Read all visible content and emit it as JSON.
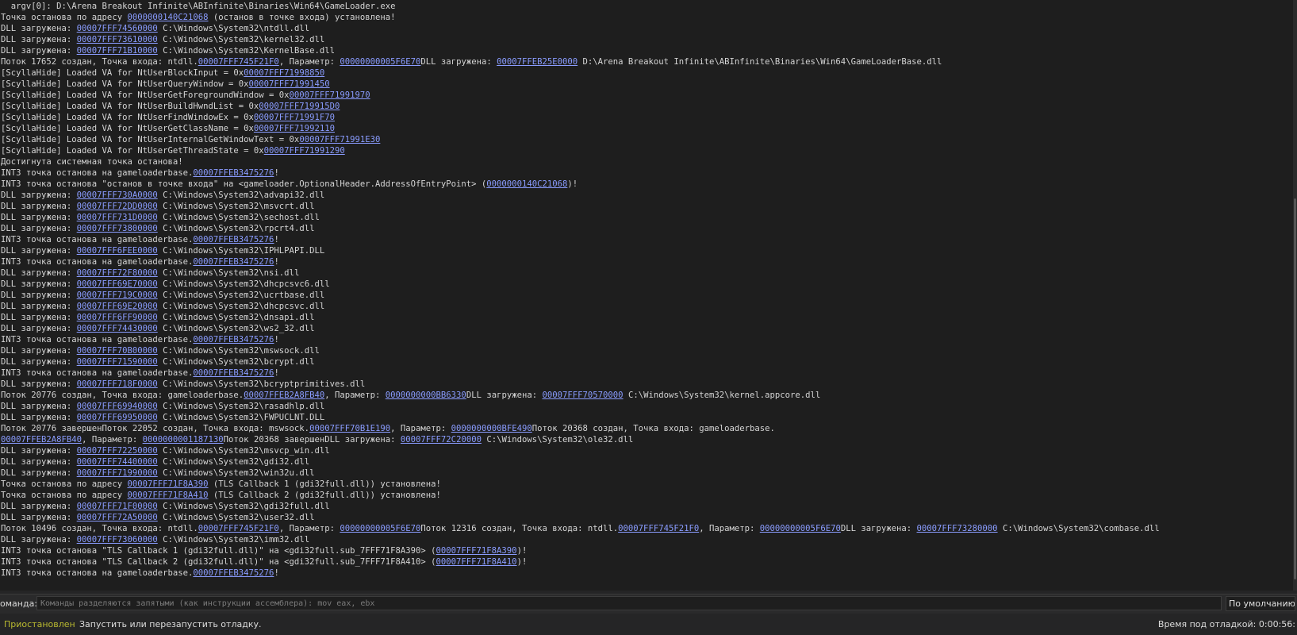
{
  "log": {
    "lines": [
      [
        {
          "t": "  argv[0]: D:\\Arena Breakout Infinite\\ABInfinite\\Binaries\\Win64\\GameLoader.exe"
        }
      ],
      [
        {
          "t": "Точка останова по адресу "
        },
        {
          "t": "0000000140C21068",
          "a": true
        },
        {
          "t": " (останов в точке входа) установлена!"
        }
      ],
      [
        {
          "t": "DLL загружена: "
        },
        {
          "t": "00007FFF74560000",
          "a": true
        },
        {
          "t": " C:\\Windows\\System32\\ntdll.dll"
        }
      ],
      [
        {
          "t": "DLL загружена: "
        },
        {
          "t": "00007FFF73610000",
          "a": true
        },
        {
          "t": " C:\\Windows\\System32\\kernel32.dll"
        }
      ],
      [
        {
          "t": "DLL загружена: "
        },
        {
          "t": "00007FFF71B10000",
          "a": true
        },
        {
          "t": " C:\\Windows\\System32\\KernelBase.dll"
        }
      ],
      [
        {
          "t": "Поток 17652 создан, Точка входа: ntdll."
        },
        {
          "t": "00007FFF745F21F0",
          "a": true
        },
        {
          "t": ", Параметр: "
        },
        {
          "t": "00000000005F6E70",
          "a": true
        },
        {
          "t": "DLL загружена: "
        },
        {
          "t": "00007FFEB25E0000",
          "a": true
        },
        {
          "t": " D:\\Arena Breakout Infinite\\ABInfinite\\Binaries\\Win64\\GameLoaderBase.dll"
        }
      ],
      [
        {
          "t": "[ScyllaHide] Loaded VA for NtUserBlockInput = 0x"
        },
        {
          "t": "00007FFF71998850",
          "a": true
        }
      ],
      [
        {
          "t": "[ScyllaHide] Loaded VA for NtUserQueryWindow = 0x"
        },
        {
          "t": "00007FFF71991450",
          "a": true
        }
      ],
      [
        {
          "t": "[ScyllaHide] Loaded VA for NtUserGetForegroundWindow = 0x"
        },
        {
          "t": "00007FFF71991970",
          "a": true
        }
      ],
      [
        {
          "t": "[ScyllaHide] Loaded VA for NtUserBuildHwndList = 0x"
        },
        {
          "t": "00007FFF719915D0",
          "a": true
        }
      ],
      [
        {
          "t": "[ScyllaHide] Loaded VA for NtUserFindWindowEx = 0x"
        },
        {
          "t": "00007FFF71991F70",
          "a": true
        }
      ],
      [
        {
          "t": "[ScyllaHide] Loaded VA for NtUserGetClassName = 0x"
        },
        {
          "t": "00007FFF71992110",
          "a": true
        }
      ],
      [
        {
          "t": "[ScyllaHide] Loaded VA for NtUserInternalGetWindowText = 0x"
        },
        {
          "t": "00007FFF71991E30",
          "a": true
        }
      ],
      [
        {
          "t": "[ScyllaHide] Loaded VA for NtUserGetThreadState = 0x"
        },
        {
          "t": "00007FFF71991290",
          "a": true
        }
      ],
      [
        {
          "t": "Достигнута системная точка останова!"
        }
      ],
      [
        {
          "t": "INT3 точка останова на gameloaderbase."
        },
        {
          "t": "00007FFEB3475276",
          "a": true
        },
        {
          "t": "!"
        }
      ],
      [
        {
          "t": "INT3 точка останова \"останов в точке входа\" на <gameloader.OptionalHeader.AddressOfEntryPoint> ("
        },
        {
          "t": "0000000140C21068",
          "a": true
        },
        {
          "t": ")!"
        }
      ],
      [
        {
          "t": "DLL загружена: "
        },
        {
          "t": "00007FFF730A0000",
          "a": true
        },
        {
          "t": " C:\\Windows\\System32\\advapi32.dll"
        }
      ],
      [
        {
          "t": "DLL загружена: "
        },
        {
          "t": "00007FFF72DD0000",
          "a": true
        },
        {
          "t": " C:\\Windows\\System32\\msvcrt.dll"
        }
      ],
      [
        {
          "t": "DLL загружена: "
        },
        {
          "t": "00007FFF731D0000",
          "a": true
        },
        {
          "t": " C:\\Windows\\System32\\sechost.dll"
        }
      ],
      [
        {
          "t": "DLL загружена: "
        },
        {
          "t": "00007FFF73800000",
          "a": true
        },
        {
          "t": " C:\\Windows\\System32\\rpcrt4.dll"
        }
      ],
      [
        {
          "t": "INT3 точка останова на gameloaderbase."
        },
        {
          "t": "00007FFEB3475276",
          "a": true
        },
        {
          "t": "!"
        }
      ],
      [
        {
          "t": "DLL загружена: "
        },
        {
          "t": "00007FFF6FEE0000",
          "a": true
        },
        {
          "t": " C:\\Windows\\System32\\IPHLPAPI.DLL"
        }
      ],
      [
        {
          "t": "INT3 точка останова на gameloaderbase."
        },
        {
          "t": "00007FFEB3475276",
          "a": true
        },
        {
          "t": "!"
        }
      ],
      [
        {
          "t": "DLL загружена: "
        },
        {
          "t": "00007FFF72F80000",
          "a": true
        },
        {
          "t": " C:\\Windows\\System32\\nsi.dll"
        }
      ],
      [
        {
          "t": "DLL загружена: "
        },
        {
          "t": "00007FFF69E70000",
          "a": true
        },
        {
          "t": " C:\\Windows\\System32\\dhcpcsvc6.dll"
        }
      ],
      [
        {
          "t": "DLL загружена: "
        },
        {
          "t": "00007FFF719C0000",
          "a": true
        },
        {
          "t": " C:\\Windows\\System32\\ucrtbase.dll"
        }
      ],
      [
        {
          "t": "DLL загружена: "
        },
        {
          "t": "00007FFF69E20000",
          "a": true
        },
        {
          "t": " C:\\Windows\\System32\\dhcpcsvc.dll"
        }
      ],
      [
        {
          "t": "DLL загружена: "
        },
        {
          "t": "00007FFF6FF90000",
          "a": true
        },
        {
          "t": " C:\\Windows\\System32\\dnsapi.dll"
        }
      ],
      [
        {
          "t": "DLL загружена: "
        },
        {
          "t": "00007FFF74430000",
          "a": true
        },
        {
          "t": " C:\\Windows\\System32\\ws2_32.dll"
        }
      ],
      [
        {
          "t": "INT3 точка останова на gameloaderbase."
        },
        {
          "t": "00007FFEB3475276",
          "a": true
        },
        {
          "t": "!"
        }
      ],
      [
        {
          "t": "DLL загружена: "
        },
        {
          "t": "00007FFF70B00000",
          "a": true
        },
        {
          "t": " C:\\Windows\\System32\\mswsock.dll"
        }
      ],
      [
        {
          "t": "DLL загружена: "
        },
        {
          "t": "00007FFF71590000",
          "a": true
        },
        {
          "t": " C:\\Windows\\System32\\bcrypt.dll"
        }
      ],
      [
        {
          "t": "INT3 точка останова на gameloaderbase."
        },
        {
          "t": "00007FFEB3475276",
          "a": true
        },
        {
          "t": "!"
        }
      ],
      [
        {
          "t": "DLL загружена: "
        },
        {
          "t": "00007FFF718F0000",
          "a": true
        },
        {
          "t": " C:\\Windows\\System32\\bcryptprimitives.dll"
        }
      ],
      [
        {
          "t": "Поток 20776 создан, Точка входа: gameloaderbase."
        },
        {
          "t": "00007FFEB2A8FB40",
          "a": true
        },
        {
          "t": ", Параметр: "
        },
        {
          "t": "0000000000BB6330",
          "a": true
        },
        {
          "t": "DLL загружена: "
        },
        {
          "t": "00007FFF70570000",
          "a": true
        },
        {
          "t": " C:\\Windows\\System32\\kernel.appcore.dll"
        }
      ],
      [
        {
          "t": "DLL загружена: "
        },
        {
          "t": "00007FFF69940000",
          "a": true
        },
        {
          "t": " C:\\Windows\\System32\\rasadhlp.dll"
        }
      ],
      [
        {
          "t": "DLL загружена: "
        },
        {
          "t": "00007FFF69950000",
          "a": true
        },
        {
          "t": " C:\\Windows\\System32\\FWPUCLNT.DLL"
        }
      ],
      [
        {
          "t": "Поток 20776 завершенПоток 22052 создан, Точка входа: mswsock."
        },
        {
          "t": "00007FFF70B1E190",
          "a": true
        },
        {
          "t": ", Параметр: "
        },
        {
          "t": "0000000000BFE490",
          "a": true
        },
        {
          "t": "Поток 20368 создан, Точка входа: gameloaderbase."
        }
      ],
      [
        {
          "t": "00007FFEB2A8FB40",
          "a": true
        },
        {
          "t": ", Параметр: "
        },
        {
          "t": "0000000001187130",
          "a": true
        },
        {
          "t": "Поток 20368 завершенDLL загружена: "
        },
        {
          "t": "00007FFF72C20000",
          "a": true
        },
        {
          "t": " C:\\Windows\\System32\\ole32.dll"
        }
      ],
      [
        {
          "t": "DLL загружена: "
        },
        {
          "t": "00007FFF72250000",
          "a": true
        },
        {
          "t": " C:\\Windows\\System32\\msvcp_win.dll"
        }
      ],
      [
        {
          "t": "DLL загружена: "
        },
        {
          "t": "00007FFF74400000",
          "a": true
        },
        {
          "t": " C:\\Windows\\System32\\gdi32.dll"
        }
      ],
      [
        {
          "t": "DLL загружена: "
        },
        {
          "t": "00007FFF71990000",
          "a": true
        },
        {
          "t": " C:\\Windows\\System32\\win32u.dll"
        }
      ],
      [
        {
          "t": "Точка останова по адресу "
        },
        {
          "t": "00007FFF71F8A390",
          "a": true
        },
        {
          "t": " (TLS Callback 1 (gdi32full.dll)) установлена!"
        }
      ],
      [
        {
          "t": "Точка останова по адресу "
        },
        {
          "t": "00007FFF71F8A410",
          "a": true
        },
        {
          "t": " (TLS Callback 2 (gdi32full.dll)) установлена!"
        }
      ],
      [
        {
          "t": "DLL загружена: "
        },
        {
          "t": "00007FFF71F00000",
          "a": true
        },
        {
          "t": " C:\\Windows\\System32\\gdi32full.dll"
        }
      ],
      [
        {
          "t": "DLL загружена: "
        },
        {
          "t": "00007FFF72A50000",
          "a": true
        },
        {
          "t": " C:\\Windows\\System32\\user32.dll"
        }
      ],
      [
        {
          "t": "Поток 10496 создан, Точка входа: ntdll."
        },
        {
          "t": "00007FFF745F21F0",
          "a": true
        },
        {
          "t": ", Параметр: "
        },
        {
          "t": "00000000005F6E70",
          "a": true
        },
        {
          "t": "Поток 12316 создан, Точка входа: ntdll."
        },
        {
          "t": "00007FFF745F21F0",
          "a": true
        },
        {
          "t": ", Параметр: "
        },
        {
          "t": "00000000005F6E70",
          "a": true
        },
        {
          "t": "DLL загружена: "
        },
        {
          "t": "00007FFF73280000",
          "a": true
        },
        {
          "t": " C:\\Windows\\System32\\combase.dll"
        }
      ],
      [
        {
          "t": "DLL загружена: "
        },
        {
          "t": "00007FFF73060000",
          "a": true
        },
        {
          "t": " C:\\Windows\\System32\\imm32.dll"
        }
      ],
      [
        {
          "t": "INT3 точка останова \"TLS Callback 1 (gdi32full.dll)\" на <gdi32full.sub_7FFF71F8A390> ("
        },
        {
          "t": "00007FFF71F8A390",
          "a": true
        },
        {
          "t": ")!"
        }
      ],
      [
        {
          "t": "INT3 точка останова \"TLS Callback 2 (gdi32full.dll)\" на <gdi32full.sub_7FFF71F8A410> ("
        },
        {
          "t": "00007FFF71F8A410",
          "a": true
        },
        {
          "t": ")!"
        }
      ],
      [
        {
          "t": "INT3 точка останова на gameloaderbase."
        },
        {
          "t": "00007FFEB3475276",
          "a": true
        },
        {
          "t": "!"
        }
      ]
    ]
  },
  "command": {
    "label": "оманда:",
    "placeholder": "Команды разделяются запятыми (как инструкции ассемблера): mov eax, ebx",
    "value": "",
    "mode": "По умолчанию"
  },
  "status": {
    "state": "Приостановлен",
    "state_color": "#b8b830",
    "message": "Запустить или перезапустить отладку.",
    "time": "Время под отладкой: 0:00:56:"
  },
  "colors": {
    "log_background": "#1e1e1e",
    "log_text": "#d4d4d4",
    "address_link": "#8a9cff"
  }
}
